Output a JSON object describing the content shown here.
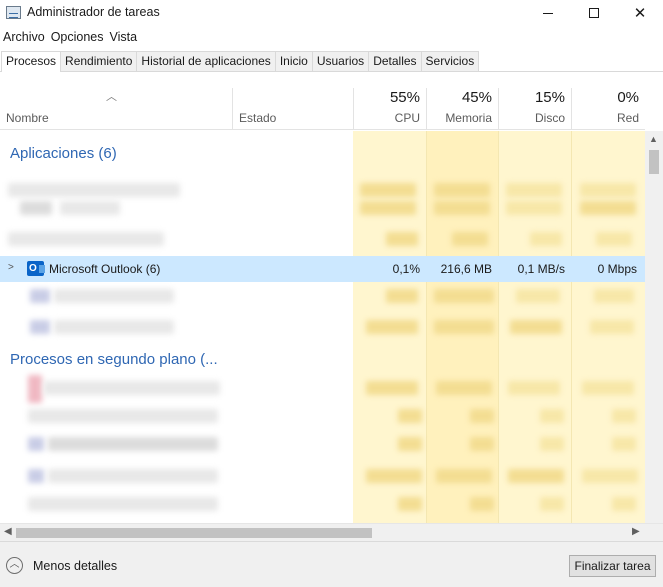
{
  "window": {
    "title": "Administrador de tareas",
    "icon": "task-manager-icon",
    "controls": [
      "minimize-icon",
      "maximize-icon",
      "close-icon"
    ]
  },
  "menu": [
    "Archivo",
    "Opciones",
    "Vista"
  ],
  "tabs": [
    {
      "label": "Procesos",
      "active": true
    },
    {
      "label": "Rendimiento",
      "active": false
    },
    {
      "label": "Historial de aplicaciones",
      "active": false
    },
    {
      "label": "Inicio",
      "active": false
    },
    {
      "label": "Usuarios",
      "active": false
    },
    {
      "label": "Detalles",
      "active": false
    },
    {
      "label": "Servicios",
      "active": false
    }
  ],
  "columns": {
    "name": "Nombre",
    "status": "Estado",
    "cpu": {
      "percent": "55%",
      "label": "CPU"
    },
    "memory": {
      "percent": "45%",
      "label": "Memoria"
    },
    "disk": {
      "percent": "15%",
      "label": "Disco"
    },
    "network": {
      "percent": "0%",
      "label": "Red"
    }
  },
  "groups": {
    "apps": "Aplicaciones (6)",
    "background": "Procesos en segundo plano (..."
  },
  "selected_row": {
    "name": "Microsoft Outlook (6)",
    "icon": "outlook-icon",
    "cpu": "0,1%",
    "memory": "216,6 MB",
    "disk": "0,1 MB/s",
    "network": "0 Mbps"
  },
  "footer": {
    "less_details": "Menos detalles",
    "end_task": "Finalizar tarea"
  },
  "colors": {
    "accent_blue": "#2f67b3",
    "selection": "#cce8ff",
    "heat_yellow": "#fff4c4"
  }
}
